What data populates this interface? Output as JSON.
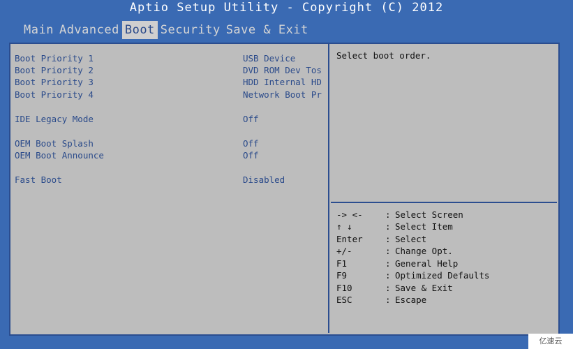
{
  "title": "Aptio Setup Utility - Copyright (C) 2012",
  "tabs": [
    {
      "label": "Main",
      "active": false
    },
    {
      "label": "Advanced",
      "active": false
    },
    {
      "label": "Boot",
      "active": true
    },
    {
      "label": "Security",
      "active": false
    },
    {
      "label": "Save & Exit",
      "active": false
    }
  ],
  "settings": [
    {
      "label": "Boot Priority 1",
      "value": "USB Device"
    },
    {
      "label": "Boot Priority 2",
      "value": "DVD ROM Dev Tos"
    },
    {
      "label": "Boot Priority 3",
      "value": "HDD Internal HD"
    },
    {
      "label": "Boot Priority 4",
      "value": "Network Boot Pr"
    },
    {
      "label": "IDE Legacy Mode",
      "value": "Off"
    },
    {
      "label": "OEM Boot Splash",
      "value": "Off"
    },
    {
      "label": "OEM Boot Announce",
      "value": "Off"
    },
    {
      "label": "Fast Boot",
      "value": "Disabled"
    }
  ],
  "help": {
    "text": "Select boot order."
  },
  "keys": [
    {
      "key": "-> <-",
      "sep": ":",
      "desc": "Select Screen"
    },
    {
      "key": "↑ ↓",
      "sep": ":",
      "desc": "Select Item"
    },
    {
      "key": "Enter",
      "sep": ":",
      "desc": "Select"
    },
    {
      "key": "+/-",
      "sep": ":",
      "desc": "Change Opt."
    },
    {
      "key": "F1",
      "sep": ":",
      "desc": "General Help"
    },
    {
      "key": "F9",
      "sep": ":",
      "desc": "Optimized Defaults"
    },
    {
      "key": "F10",
      "sep": ":",
      "desc": "Save & Exit"
    },
    {
      "key": "ESC",
      "sep": ":",
      "desc": "Escape"
    }
  ],
  "watermark": "亿速云",
  "colors": {
    "background": "#3a6ab3",
    "panel": "#bdbdbd",
    "setting_text": "#2a4a8a",
    "active_tab_bg": "#cfcfcf"
  }
}
